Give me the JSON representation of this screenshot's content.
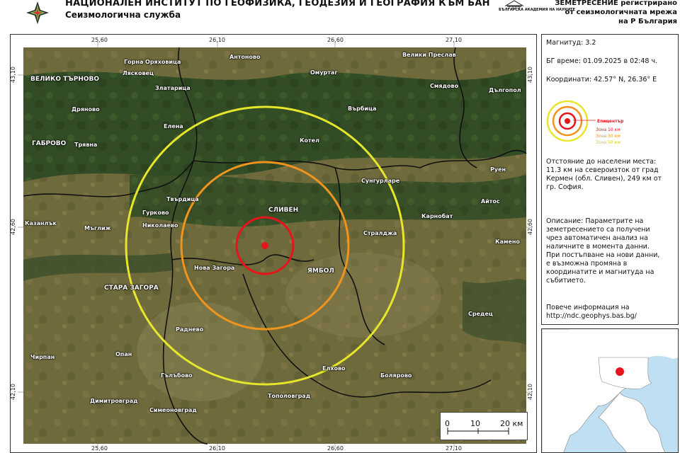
{
  "header": {
    "institute_name": "НАЦИОНАЛЕН ИНСТИТУТ ПО ГЕОФИЗИКА, ГЕОДЕЗИЯ И ГЕОГРАФИЯ КЪМ БАН",
    "institute_sub": "Сеизмологична служба",
    "academy_logo_text": "БЪЛГАРСКА АКАДЕМИЯ НА НАУКИТЕ",
    "headline_1": "ЗЕМЕТРЕСЕНИЕ регистрирано",
    "headline_2": "от сеизмологичната мрежа",
    "headline_3": "на Р България"
  },
  "map": {
    "ticks_top": [
      "25,60",
      "26,10",
      "26,60",
      "27,10"
    ],
    "ticks_bottom": [
      "25,60",
      "26,10",
      "26,60",
      "27,10"
    ],
    "ticks_left": [
      "43,10",
      "42,60",
      "42,10"
    ],
    "ticks_right": [
      "43,10",
      "42,60",
      "42,10"
    ],
    "towns": {
      "gorna_oryahovitsa": "Горна Оряховица",
      "lyaskovets": "Лясковец",
      "antonovo": "Антоново",
      "veliki_preslav": "Велики Преслав",
      "veliko_tarnovo": "ВЕЛИКО ТЪРНОВО",
      "zlataritsa": "Златарица",
      "omurtag": "Омуртаг",
      "smyadovo": "Смядово",
      "dalgopol": "Дългопол",
      "dryanovo": "Дряново",
      "varbitsa": "Върбица",
      "elena": "Елена",
      "gabrovo": "ГАБРОВО",
      "tryavna": "Трявна",
      "kotel": "Котел",
      "ruen": "Руен",
      "tvarditsa": "Твърдица",
      "sungurlare": "Сунгурларе",
      "aytos": "Айтос",
      "gurkovo": "Гурково",
      "sliven": "СЛИВЕН",
      "karnobat": "Карнобат",
      "kazanlak": "Казанлък",
      "maglizh": "Мъглиж",
      "nikolaevo": "Николаево",
      "straldzha": "Стралджа",
      "kameno": "Камено",
      "nova_zagora": "Нова Загора",
      "yambol": "ЯМБОЛ",
      "stara_zagora": "СТАРА ЗАГОРА",
      "sredets": "Средец",
      "radnevo": "Раднево",
      "chirpan": "Чирпан",
      "opan": "Опан",
      "elhovo": "Елхово",
      "bolyarovo": "Болярово",
      "galabovo": "Гълъбово",
      "dimitrovgrad": "Димитровград",
      "toplovgrad": "Тополовград",
      "simeonovgrad": "Симеоновград"
    },
    "scalebar": {
      "zero": "0",
      "mid": "10",
      "end": "20 км"
    }
  },
  "event": {
    "magnitude_line": "Магнитуд: 3.2",
    "time_line": "БГ време: 01.09.2025 в 02:48 ч.",
    "coords_line": "Координати: 42.57° N, 26.36° E",
    "magnitude": 3.2,
    "lat": 42.57,
    "lon": 26.36
  },
  "legend": {
    "epicenter": "Епицентър",
    "zone10": "Зона 10 км",
    "zone30": "Зона 30 км",
    "zone50": "Зона 50 км",
    "colors": {
      "epicenter": "#e8141b",
      "zone10": "#e8141b",
      "zone30": "#f0941d",
      "zone50": "#e6e62a"
    }
  },
  "distance": {
    "title": "Отстояние до населени места:",
    "text": "11.3 км на североизток от град\nКермен (обл. Сливен), 249 км от\nгр. София."
  },
  "description": {
    "text": "Описание: Параметрите на\nземетресението са получени\nчрез автоматичен анализ на\nналичните в момента данни.\nПри постъпване на нови данни,\nе възможна промяна в\nкоординатите и магнитуда на\nсъбитието."
  },
  "more_info": {
    "label": "Повече информация на",
    "url": "http://ndc.geophys.bas.bg/"
  }
}
